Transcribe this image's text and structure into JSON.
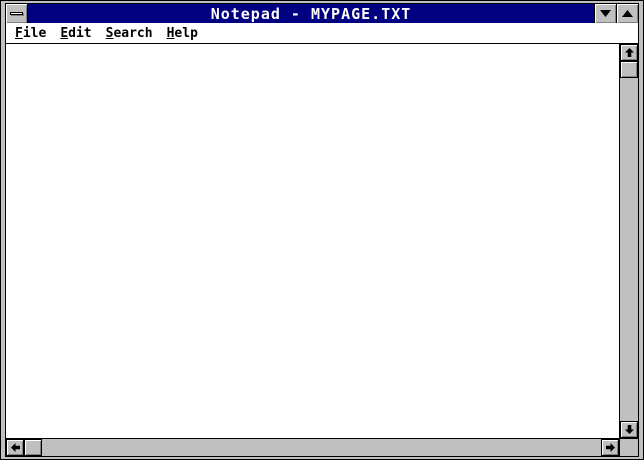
{
  "window": {
    "title": "Notepad - MYPAGE.TXT"
  },
  "menu_bar": {
    "items": [
      {
        "label": "File"
      },
      {
        "label": "Edit"
      },
      {
        "label": "Search"
      },
      {
        "label": "Help"
      }
    ]
  },
  "editor": {
    "content": ""
  },
  "scrollbars": {
    "vertical": {
      "thumb_position": "top"
    },
    "horizontal": {
      "thumb_position": "left"
    }
  },
  "icons": {
    "system_menu_icon": "horizontal-minus-bar",
    "minimize_icon": "down-triangle",
    "maximize_icon": "up-triangle",
    "scroll_up_icon": "up-arrow",
    "scroll_down_icon": "down-arrow",
    "scroll_left_icon": "left-arrow",
    "scroll_right_icon": "right-arrow"
  },
  "colors": {
    "title_bar": "#000080",
    "title_text": "#ffffff",
    "chrome": "#c0c0c0",
    "shadow": "#808080",
    "text_area": "#ffffff",
    "outline": "#000000"
  }
}
